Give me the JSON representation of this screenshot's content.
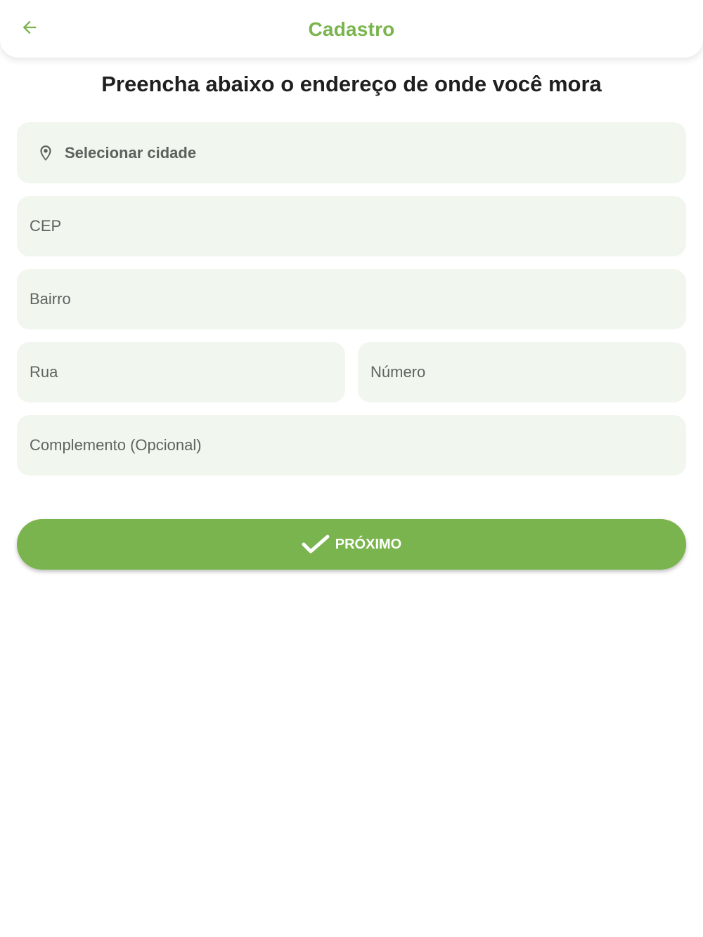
{
  "header": {
    "title": "Cadastro",
    "back_icon": "arrow-left-icon",
    "accent_color": "#7ab44e"
  },
  "main": {
    "heading": "Preencha abaixo o endereço de onde você mora",
    "city_select": {
      "label": "Selecionar cidade",
      "icon": "location-pin-icon"
    },
    "fields": {
      "cep": "CEP",
      "bairro": "Bairro",
      "rua": "Rua",
      "numero": "Número",
      "complemento": "Complemento (Opcional)"
    },
    "next_button": {
      "label": "PRÓXIMO",
      "icon": "checkmark-icon"
    },
    "field_background": "#f1f6ee"
  }
}
